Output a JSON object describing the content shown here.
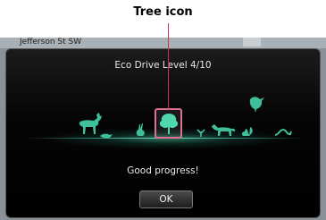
{
  "callout": {
    "label": "Tree icon"
  },
  "map": {
    "street_text": "Jefferson St SW"
  },
  "dialog": {
    "title": "Eco Drive Level 4/10",
    "message": "Good progress!",
    "ok_label": "OK"
  },
  "colors": {
    "highlight": "#e07090",
    "eco_green": "#3fbf9a",
    "dialog_bg": "#000000"
  },
  "icons": [
    "deer-icon",
    "bird-icon",
    "rabbit-icon",
    "tree-icon",
    "grass-icon",
    "fox-icon",
    "squirrel-icon",
    "parrot-icon",
    "snake-icon"
  ]
}
